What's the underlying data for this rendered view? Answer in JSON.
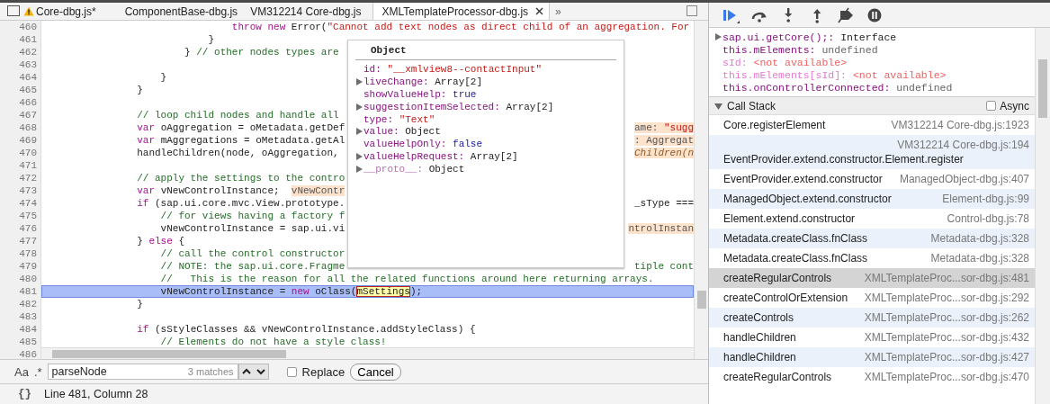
{
  "editor_tabs": [
    {
      "label": "Core-dbg.js*",
      "warning": true,
      "selected": false
    },
    {
      "label": "ComponentBase-dbg.js",
      "warning": false,
      "selected": false
    },
    {
      "label": "VM312214 Core-dbg.js",
      "warning": false,
      "selected": false
    },
    {
      "label": "XMLTemplateProcessor-dbg.js",
      "warning": false,
      "selected": true
    }
  ],
  "tabs_overflow": "»",
  "code_lines": [
    {
      "number": "460",
      "current": false,
      "left": [
        {
          "kind": "keyword",
          "text": "                            throw new"
        },
        {
          "kind": "plain",
          "text": " Error("
        },
        {
          "kind": "string",
          "text": "\"Cannot add text nodes as direct child of an aggregation. For"
        }
      ]
    },
    {
      "number": "461",
      "current": false,
      "left": [
        {
          "kind": "plain",
          "text": "                        }"
        }
      ]
    },
    {
      "number": "462",
      "current": false,
      "left": [
        {
          "kind": "plain",
          "text": "                    } "
        },
        {
          "kind": "comment",
          "text": "// other nodes types are"
        }
      ]
    },
    {
      "number": "463",
      "current": false
    },
    {
      "number": "464",
      "current": false,
      "left": [
        {
          "kind": "plain",
          "text": "                }"
        }
      ]
    },
    {
      "number": "465",
      "current": false,
      "left": [
        {
          "kind": "plain",
          "text": "            }"
        }
      ]
    },
    {
      "number": "466",
      "current": false
    },
    {
      "number": "467",
      "current": false,
      "left": [
        {
          "kind": "comment",
          "text": "            // loop child nodes and handle all"
        }
      ]
    },
    {
      "number": "468",
      "current": false,
      "left": [
        {
          "kind": "keyword",
          "text": "            var"
        },
        {
          "kind": "plain",
          "text": " oAggregation = oMetadata.getDef"
        }
      ],
      "right": [
        {
          "kind": "inline",
          "text": "ame: "
        },
        {
          "kind": "inline-string",
          "text": "\"sugg"
        }
      ]
    },
    {
      "number": "469",
      "current": false,
      "left": [
        {
          "kind": "keyword",
          "text": "            var"
        },
        {
          "kind": "plain",
          "text": " mAggregations = oMetadata.getAl"
        }
      ],
      "right": [
        {
          "kind": "inline",
          "text": ": Aggregat"
        }
      ]
    },
    {
      "number": "470",
      "current": false,
      "left": [
        {
          "kind": "plain",
          "text": "            handleChildren(node, oAggregation,"
        }
      ],
      "right": [
        {
          "kind": "inline-italic",
          "text": "Children(n"
        }
      ]
    },
    {
      "number": "471",
      "current": false
    },
    {
      "number": "472",
      "current": false,
      "left": [
        {
          "kind": "comment",
          "text": "            // apply the settings to the contro"
        }
      ]
    },
    {
      "number": "473",
      "current": false,
      "left": [
        {
          "kind": "keyword",
          "text": "            var"
        },
        {
          "kind": "plain",
          "text": " vNewControlInstance;  "
        },
        {
          "kind": "inline",
          "text": "vNewContr"
        }
      ]
    },
    {
      "number": "474",
      "current": false,
      "left": [
        {
          "kind": "keyword",
          "text": "            if"
        },
        {
          "kind": "plain",
          "text": " (sap.ui.core.mvc.View.prototype."
        }
      ],
      "right": [
        {
          "kind": "plain",
          "text": "_sType ==="
        }
      ]
    },
    {
      "number": "475",
      "current": false,
      "left": [
        {
          "kind": "comment",
          "text": "                // for views having a factory f"
        }
      ]
    },
    {
      "number": "476",
      "current": false,
      "left": [
        {
          "kind": "plain",
          "text": "                vNewControlInstance = sap.ui.vi"
        }
      ],
      "right": [
        {
          "kind": "inline",
          "text": "ntrolInstan"
        }
      ]
    },
    {
      "number": "477",
      "current": false,
      "left": [
        {
          "kind": "plain",
          "text": "            } "
        },
        {
          "kind": "keyword",
          "text": "else"
        },
        {
          "kind": "plain",
          "text": " {"
        }
      ]
    },
    {
      "number": "478",
      "current": false,
      "left": [
        {
          "kind": "comment",
          "text": "                // call the control constructor"
        }
      ]
    },
    {
      "number": "479",
      "current": false,
      "left": [
        {
          "kind": "comment",
          "text": "                // NOTE: the sap.ui.core.Fragme"
        }
      ],
      "right": [
        {
          "kind": "comment",
          "text": "tiple cont"
        }
      ]
    },
    {
      "number": "480",
      "current": false,
      "left": [
        {
          "kind": "comment",
          "text": "                //   This is the reason for all the related functions around here returning arrays."
        }
      ]
    },
    {
      "number": "481",
      "current": true,
      "left": [
        {
          "kind": "plain",
          "text": "                vNewControlInstance = "
        },
        {
          "kind": "keyword",
          "text": "new"
        },
        {
          "kind": "plain",
          "text": " oClass("
        },
        {
          "kind": "match",
          "text": "mSettings"
        },
        {
          "kind": "plain",
          "text": ");"
        }
      ]
    },
    {
      "number": "482",
      "current": false,
      "left": [
        {
          "kind": "plain",
          "text": "            }"
        }
      ]
    },
    {
      "number": "483",
      "current": false
    },
    {
      "number": "484",
      "current": false,
      "left": [
        {
          "kind": "keyword",
          "text": "            if"
        },
        {
          "kind": "plain",
          "text": " (sStyleClasses && vNewControlInstance.addStyleClass) {"
        }
      ]
    },
    {
      "number": "485",
      "current": false,
      "left": [
        {
          "kind": "comment",
          "text": "                // Elements do not have a style class!"
        }
      ]
    },
    {
      "number": "486"
    }
  ],
  "popover": {
    "title": "Object",
    "properties": [
      {
        "name": "id:",
        "value": "\"__xmlview8--contactInput\"",
        "kind": "string",
        "expandable": false,
        "internal": false
      },
      {
        "name": "liveChange:",
        "value": "Array[2]",
        "kind": "object",
        "expandable": true,
        "internal": false
      },
      {
        "name": "showValueHelp:",
        "value": "true",
        "kind": "boolean",
        "expandable": false,
        "internal": false
      },
      {
        "name": "suggestionItemSelected:",
        "value": "Array[2]",
        "kind": "object",
        "expandable": true,
        "internal": false
      },
      {
        "name": "type:",
        "value": "\"Text\"",
        "kind": "string",
        "expandable": false,
        "internal": false
      },
      {
        "name": "value:",
        "value": "Object",
        "kind": "object",
        "expandable": true,
        "internal": false
      },
      {
        "name": "valueHelpOnly:",
        "value": "false",
        "kind": "boolean",
        "expandable": false,
        "internal": false
      },
      {
        "name": "valueHelpRequest:",
        "value": "Array[2]",
        "kind": "object",
        "expandable": true,
        "internal": false
      },
      {
        "name": "__proto__:",
        "value": "Object",
        "kind": "object",
        "expandable": true,
        "internal": true
      }
    ]
  },
  "search_bar": {
    "case_label": "Aa",
    "regex_label": ".*",
    "value": "parseNode",
    "matches": "3 matches",
    "replace_checked": false,
    "replace_label": "Replace",
    "cancel_label": "Cancel"
  },
  "status_bar": {
    "format_label": "{}",
    "position": "Line 481, Column 28"
  },
  "debugger_toolbar": [
    {
      "kind": "resume",
      "active": true
    },
    {
      "kind": "step-over",
      "active": false
    },
    {
      "kind": "step-into",
      "active": false
    },
    {
      "kind": "step-out",
      "active": false
    },
    {
      "kind": "deactivate",
      "active": false
    },
    {
      "kind": "pause",
      "active": false
    }
  ],
  "watch_expressions": [
    {
      "expression": "sap.ui.getCore();:",
      "value": " Interface",
      "expandable": true,
      "available": true
    },
    {
      "expression": "this.mElements:",
      "value": " undefined",
      "expandable": false,
      "available": true
    },
    {
      "expression": "sId:",
      "value": " <not available>",
      "expandable": false,
      "available": false
    },
    {
      "expression": "this.mElements[sId]:",
      "value": " <not available>",
      "expandable": false,
      "available": false
    },
    {
      "expression": "this.onControllerConnected:",
      "value": " undefined",
      "expandable": false,
      "available": true
    }
  ],
  "call_stack": {
    "title": "Call Stack",
    "expanded": true,
    "async_label": "Async",
    "async_checked": false,
    "frames": [
      {
        "function": "Core.registerElement",
        "location": "VM312214 Core-dbg.js:1923",
        "selected": false
      },
      {
        "function": "EventProvider.extend.constructor.Element.register",
        "location": "VM312214 Core-dbg.js:194",
        "selected": false
      },
      {
        "function": "EventProvider.extend.constructor",
        "location": "ManagedObject-dbg.js:407",
        "selected": false
      },
      {
        "function": "ManagedObject.extend.constructor",
        "location": "Element-dbg.js:99",
        "selected": false
      },
      {
        "function": "Element.extend.constructor",
        "location": "Control-dbg.js:78",
        "selected": false
      },
      {
        "function": "Metadata.createClass.fnClass",
        "location": "Metadata-dbg.js:328",
        "selected": false
      },
      {
        "function": "Metadata.createClass.fnClass",
        "location": "Metadata-dbg.js:328",
        "selected": false
      },
      {
        "function": "createRegularControls",
        "location": "XMLTemplateProc...sor-dbg.js:481",
        "selected": true
      },
      {
        "function": "createControlOrExtension",
        "location": "XMLTemplateProc...sor-dbg.js:292",
        "selected": false
      },
      {
        "function": "createControls",
        "location": "XMLTemplateProc...sor-dbg.js:262",
        "selected": false
      },
      {
        "function": "handleChildren",
        "location": "XMLTemplateProc...sor-dbg.js:432",
        "selected": false
      },
      {
        "function": "handleChildren",
        "location": "XMLTemplateProc...sor-dbg.js:427",
        "selected": false
      },
      {
        "function": "createRegularControls",
        "location": "XMLTemplateProc...sor-dbg.js:470",
        "selected": false
      }
    ]
  }
}
